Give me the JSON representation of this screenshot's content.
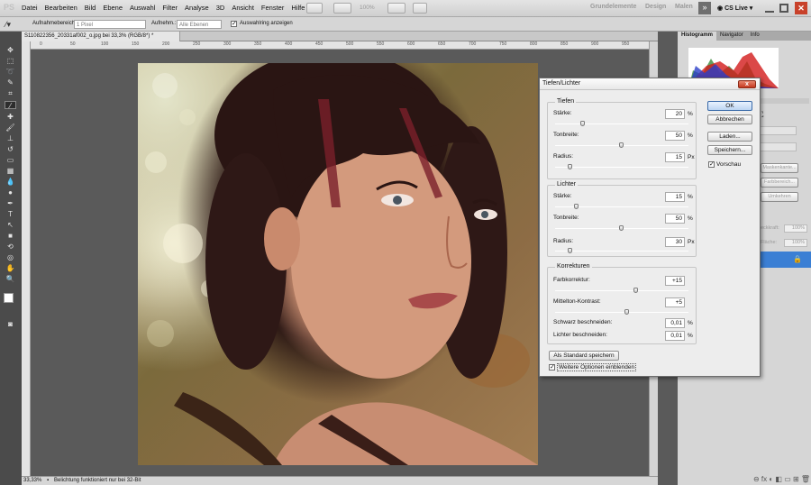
{
  "app": {
    "logo": "PS",
    "menu": [
      "Datei",
      "Bearbeiten",
      "Bild",
      "Ebene",
      "Auswahl",
      "Filter",
      "Analyse",
      "3D",
      "Ansicht",
      "Fenster",
      "Hilfe"
    ],
    "zoom": "100%",
    "workspaces": [
      "Grundelemente",
      "Design",
      "Malen"
    ],
    "cslive": "CS Live"
  },
  "options": {
    "sample_label": "Aufnahmebereich:",
    "sample_value": "1 Pixel",
    "sample2_label": "Aufnehm.:",
    "sample2_value": "Alle Ebenen",
    "ring_label": "Auswahlring anzeigen"
  },
  "document": {
    "tab": "S110822356_20331af002_o.jpg bei 33,3% (RGB/8*) *",
    "zoom": "33,33%",
    "status": "Belichtung funktioniert nur bei 32-Bit"
  },
  "ruler": [
    "0",
    "50",
    "100",
    "150",
    "200",
    "250",
    "300",
    "350",
    "400",
    "450",
    "500",
    "550",
    "600",
    "650",
    "700",
    "750",
    "800",
    "850",
    "900",
    "950"
  ],
  "panels": {
    "tabs": [
      "Histogramm",
      "Navigator",
      "Info"
    ],
    "side_buttons": [
      "Maskenkante...",
      "Farbbereich...",
      "Umkehren"
    ],
    "layer_fields": [
      "Deckkraft:",
      "Fläche:"
    ],
    "layer_values": [
      "100%",
      "100%"
    ]
  },
  "dialog": {
    "title": "Tiefen/Lichter",
    "tiefen": {
      "title": "Tiefen",
      "rows": [
        {
          "label": "Stärke:",
          "value": "20",
          "unit": "%",
          "pos": 0.2
        },
        {
          "label": "Tonbreite:",
          "value": "50",
          "unit": "%",
          "pos": 0.5
        },
        {
          "label": "Radius:",
          "value": "15",
          "unit": "Px",
          "pos": 0.1
        }
      ]
    },
    "lichter": {
      "title": "Lichter",
      "rows": [
        {
          "label": "Stärke:",
          "value": "15",
          "unit": "%",
          "pos": 0.15
        },
        {
          "label": "Tonbreite:",
          "value": "50",
          "unit": "%",
          "pos": 0.5
        },
        {
          "label": "Radius:",
          "value": "30",
          "unit": "Px",
          "pos": 0.1
        }
      ]
    },
    "korrekturen": {
      "title": "Korrekturen",
      "farb_label": "Farbkorrektur:",
      "farb_value": "+15",
      "mitt_label": "Mittelton-Kontrast:",
      "mitt_value": "+5",
      "schwarz_label": "Schwarz beschneiden:",
      "schwarz_value": "0,01",
      "lichter_label": "Lichter beschneiden:",
      "lichter_value": "0,01",
      "unit": "%"
    },
    "buttons": {
      "ok": "OK",
      "cancel": "Abbrechen",
      "load": "Laden...",
      "save": "Speichern...",
      "preview": "Vorschau",
      "default": "Als Standard speichern",
      "more": "Weitere Optionen einblenden"
    },
    "close": "x"
  }
}
